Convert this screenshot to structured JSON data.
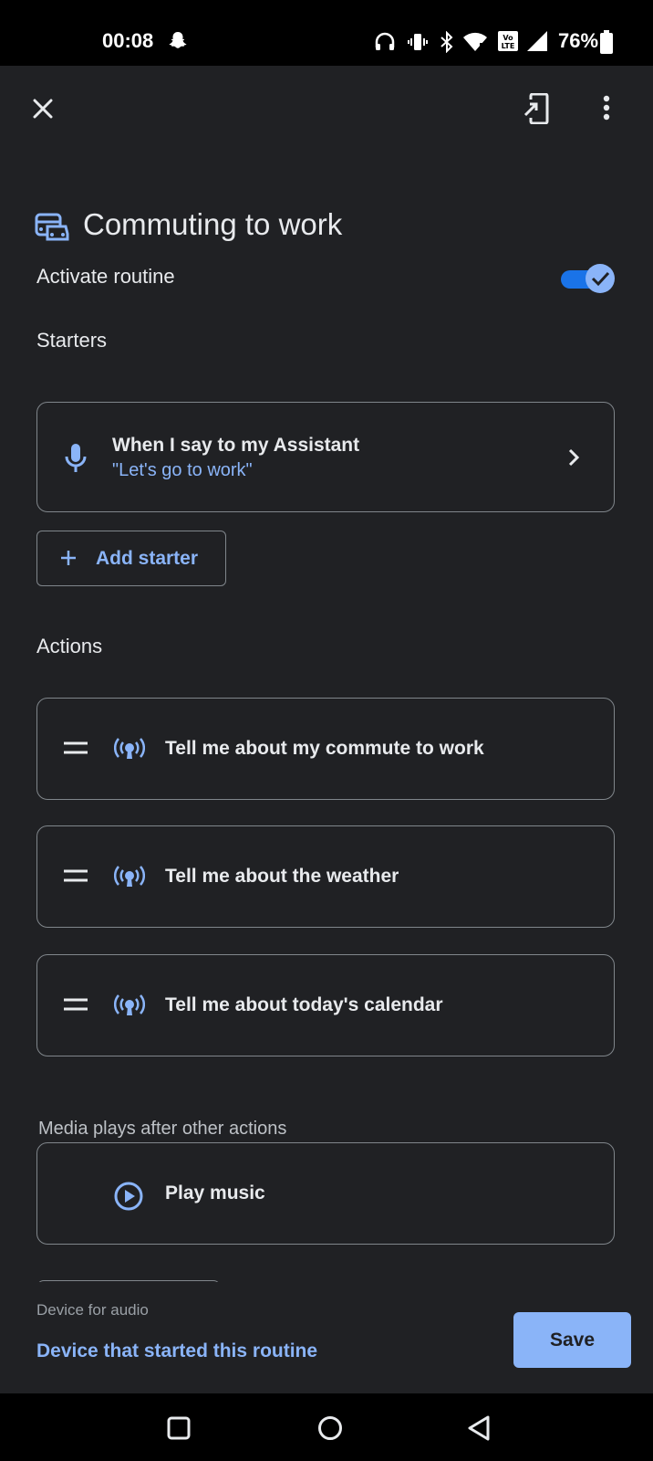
{
  "status_bar": {
    "time": "00:08",
    "battery": "76%",
    "icons": [
      "snapchat-icon",
      "headphones-icon",
      "vibrate-icon",
      "bluetooth-icon",
      "wifi-icon",
      "volte-icon",
      "signal-icon",
      "battery-icon"
    ]
  },
  "top_bar": {
    "icons": [
      "close-icon",
      "add-to-home-icon",
      "more-vert-icon"
    ]
  },
  "routine": {
    "title": "Commuting to work",
    "icon": "commute-icon",
    "activate_label": "Activate routine",
    "activated": true
  },
  "starters": {
    "heading": "Starters",
    "items": [
      {
        "title": "When I say to my Assistant",
        "phrase": "\"Let's go to work\"",
        "icon": "mic-icon"
      }
    ],
    "add_label": "Add starter"
  },
  "actions": {
    "heading": "Actions",
    "items": [
      {
        "label": "Tell me about my commute to work",
        "icon": "broadcast-icon"
      },
      {
        "label": "Tell me about the weather",
        "icon": "broadcast-icon"
      },
      {
        "label": "Tell me about today's calendar",
        "icon": "broadcast-icon"
      }
    ],
    "media_note": "Media plays after other actions",
    "media": {
      "label": "Play music",
      "icon": "play-circle-icon"
    }
  },
  "bottom_sheet": {
    "audio_caption": "Device for audio",
    "audio_device": "Device that started this routine",
    "save_label": "Save"
  },
  "colors": {
    "background": "#202124",
    "accent": "#8ab4f8",
    "toggle_track": "#1a73e8",
    "outline": "#80868b"
  }
}
